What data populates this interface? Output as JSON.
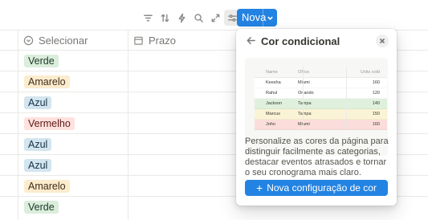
{
  "toolbar": {
    "icons": [
      "filter-icon",
      "sort-icon",
      "lightning-icon",
      "search-icon",
      "expand-icon",
      "settings-sliders-icon"
    ],
    "new_button_label": "Nova"
  },
  "table": {
    "columns": [
      {
        "label": "Selecionar",
        "icon": "select-circle-icon"
      },
      {
        "label": "Prazo",
        "icon": "calendar-icon"
      }
    ],
    "rows": [
      {
        "tag": "Verde",
        "bg": "#dbeddb",
        "fg": "#1c3829"
      },
      {
        "tag": "Amarelo",
        "bg": "#fbeccd",
        "fg": "#402c1b"
      },
      {
        "tag": "Azul",
        "bg": "#d3e5ef",
        "fg": "#183347"
      },
      {
        "tag": "Vermelho",
        "bg": "#ffe2dd",
        "fg": "#5d1715"
      },
      {
        "tag": "Azul",
        "bg": "#d3e5ef",
        "fg": "#183347"
      },
      {
        "tag": "Azul",
        "bg": "#d3e5ef",
        "fg": "#183347"
      },
      {
        "tag": "Amarelo",
        "bg": "#fbeccd",
        "fg": "#402c1b"
      },
      {
        "tag": "Verde",
        "bg": "#dbeddb",
        "fg": "#1c3829"
      }
    ]
  },
  "popup": {
    "title": "Cor condicional",
    "description": "Personalize as cores da página para distinguir facilmente as categorias, destacar eventos atrasados e tornar o seu cronograma mais claro.",
    "action_label": "Nova configuração de cor",
    "preview": {
      "headers": [
        "Name",
        "Office",
        "Units sold"
      ],
      "rows": [
        {
          "name": "Keesha",
          "office": "Miami",
          "units": "160",
          "bg": "#ffffff"
        },
        {
          "name": "Rahul",
          "office": "Orlando",
          "units": "120",
          "bg": "#ffffff"
        },
        {
          "name": "Jackson",
          "office": "Tampa",
          "units": "140",
          "bg": "#dff0dc"
        },
        {
          "name": "Marcus",
          "office": "Tampa",
          "units": "150",
          "bg": "#fbf3d5"
        },
        {
          "name": "John",
          "office": "Miami",
          "units": "160",
          "bg": "#fbdedb"
        }
      ]
    }
  },
  "colors": {
    "accent": "#2383e2"
  }
}
